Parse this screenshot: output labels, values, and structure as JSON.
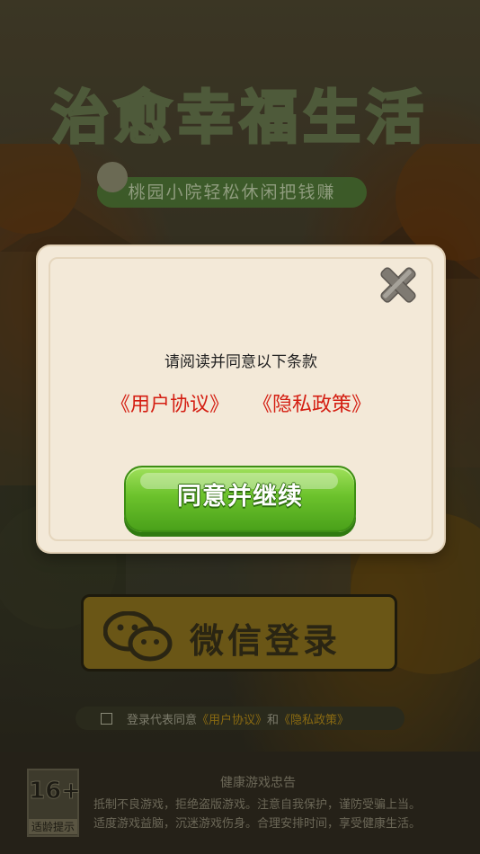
{
  "background": {
    "title": "治愈幸福生活",
    "subtitle": "桃园小院轻松休闲把钱赚",
    "login_button": {
      "label": "微信登录",
      "icon": "wechat-icon"
    },
    "agreement": {
      "prefix": "登录代表同意",
      "user_agreement": "《用户协议》",
      "and": "和",
      "privacy_policy": "《隐私政策》"
    },
    "footer": {
      "age_rating": "16+",
      "age_label": "适龄提示",
      "health_title": "健康游戏忠告",
      "health_line1": "抵制不良游戏，拒绝盗版游戏。注意自我保护，谨防受骗上当。",
      "health_line2": "适度游戏益脑，沉迷游戏伤身。合理安排时间，享受健康生活。"
    }
  },
  "dialog": {
    "message": "请阅读并同意以下条款",
    "user_agreement_link": "《用户协议》",
    "privacy_policy_link": "《隐私政策》",
    "confirm_button": "同意并继续",
    "close_icon": "close-icon",
    "colors": {
      "link": "#d41e12",
      "button": "#6cc22c",
      "panel": "#f3e9d8"
    }
  }
}
